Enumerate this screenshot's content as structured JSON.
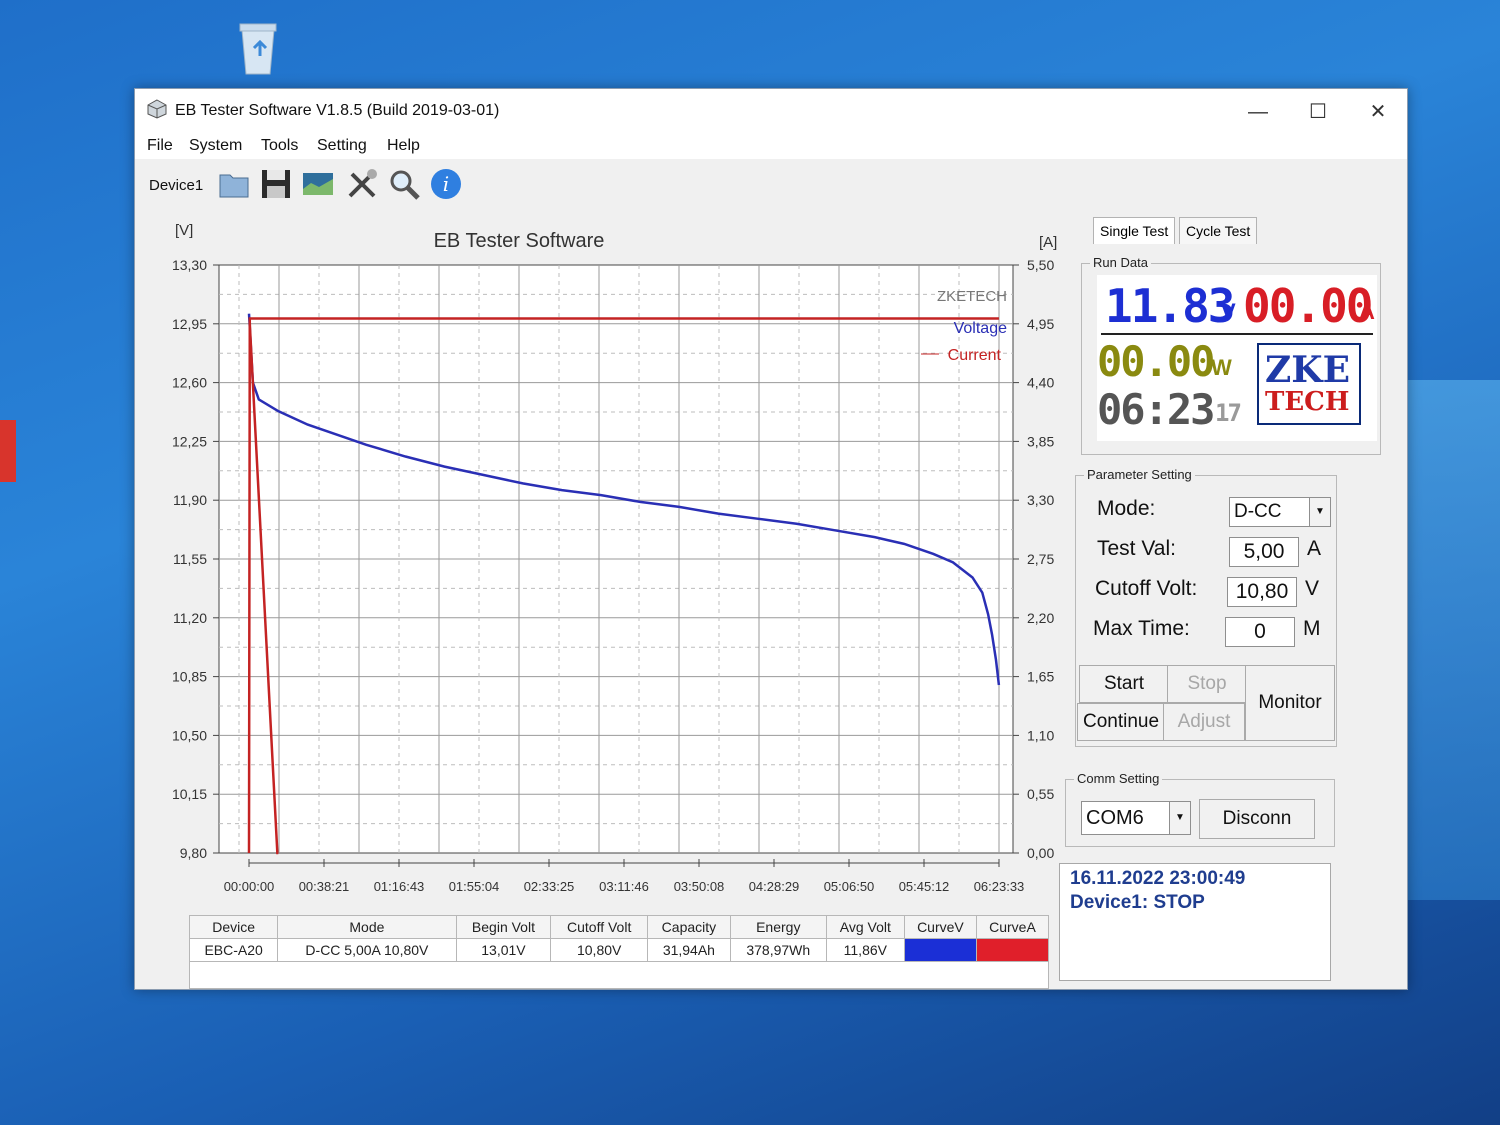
{
  "window": {
    "title": "EB Tester Software V1.8.5 (Build 2019-03-01)",
    "controls": [
      "—",
      "☐",
      "✕"
    ]
  },
  "menu": [
    "File",
    "System",
    "Tools",
    "Setting",
    "Help"
  ],
  "toolbar": {
    "device_label": "Device1",
    "icons": [
      "open-icon",
      "save-icon",
      "chart-image-icon",
      "tools-icon",
      "search-icon",
      "info-icon"
    ]
  },
  "chart_data": {
    "type": "line",
    "title": "EB Tester Software",
    "watermark": "ZKETECH",
    "y_left_unit": "[V]",
    "y_right_unit": "[A]",
    "y_left_ticks": [
      "13,30",
      "12,95",
      "12,60",
      "12,25",
      "11,90",
      "11,55",
      "11,20",
      "10,85",
      "10,50",
      "10,15",
      "9,80"
    ],
    "y_right_ticks": [
      "5,50",
      "4,95",
      "4,40",
      "3,85",
      "3,30",
      "2,75",
      "2,20",
      "1,65",
      "1,10",
      "0,55",
      "0,00"
    ],
    "x_ticks": [
      "00:00:00",
      "00:38:21",
      "01:16:43",
      "01:55:04",
      "02:33:25",
      "03:11:46",
      "03:50:08",
      "04:28:29",
      "05:06:50",
      "05:45:12",
      "06:23:33"
    ],
    "ylim_left": [
      9.8,
      13.3
    ],
    "ylim_right": [
      0,
      5.5
    ],
    "xlim_minutes": [
      0,
      383.55
    ],
    "legend": [
      {
        "name": "Voltage",
        "color": "#2a2fb5"
      },
      {
        "name": "Current",
        "color": "#c42323"
      }
    ],
    "series": [
      {
        "name": "Voltage",
        "axis": "left",
        "x_minutes": [
          0,
          2,
          5,
          15,
          30,
          45,
          60,
          80,
          100,
          120,
          140,
          160,
          180,
          200,
          220,
          240,
          260,
          280,
          300,
          320,
          335,
          350,
          360,
          370,
          375,
          378,
          380,
          382,
          383.5
        ],
        "values": [
          13.01,
          12.6,
          12.5,
          12.43,
          12.35,
          12.29,
          12.23,
          12.16,
          12.1,
          12.05,
          12.0,
          11.96,
          11.93,
          11.89,
          11.86,
          11.82,
          11.79,
          11.76,
          11.72,
          11.68,
          11.64,
          11.58,
          11.53,
          11.44,
          11.35,
          11.22,
          11.1,
          10.95,
          10.8
        ]
      },
      {
        "name": "Current",
        "axis": "right",
        "x_minutes": [
          0,
          0.4,
          1,
          383.5
        ],
        "values": [
          0,
          5.0,
          5.0,
          5.0
        ]
      },
      {
        "name": "VoltageDrop",
        "axis": "left",
        "x_minutes": [
          0,
          0.4,
          14.5,
          15
        ],
        "values": [
          12.95,
          12.95,
          9.8,
          9.8
        ]
      }
    ]
  },
  "result_table": {
    "headers": [
      "Device",
      "Mode",
      "Begin Volt",
      "Cutoff Volt",
      "Capacity",
      "Energy",
      "Avg Volt",
      "CurveV",
      "CurveA"
    ],
    "row": [
      "EBC-A20",
      "D-CC 5,00A 10,80V",
      "13,01V",
      "10,80V",
      "31,94Ah",
      "378,97Wh",
      "11,86V",
      "",
      ""
    ],
    "curve_v_color": "#1b2fd6",
    "curve_a_color": "#e01f2a"
  },
  "tabs": [
    "Single Test",
    "Cycle Test"
  ],
  "run_data": {
    "label": "Run Data",
    "voltage": "11.83",
    "voltage_unit": "V",
    "current": "00.00",
    "current_unit": "A",
    "power": "00.00",
    "power_unit": "W",
    "time": "06:23",
    "time_seconds": "17",
    "logo_top": "ZKE",
    "logo_bottom": "TECH"
  },
  "param": {
    "label": "Parameter Setting",
    "mode_label": "Mode:",
    "mode_value": "D-CC",
    "test_label": "Test Val:",
    "test_value": "5,00",
    "test_unit": "A",
    "cutoff_label": "Cutoff Volt:",
    "cutoff_value": "10,80",
    "cutoff_unit": "V",
    "maxtime_label": "Max Time:",
    "maxtime_value": "0",
    "maxtime_unit": "M"
  },
  "buttons": {
    "start": "Start",
    "stop": "Stop",
    "continue": "Continue",
    "adjust": "Adjust",
    "monitor": "Monitor"
  },
  "comm": {
    "label": "Comm Setting",
    "port": "COM6",
    "disconnect": "Disconn"
  },
  "status": {
    "datetime": "16.11.2022 23:00:49",
    "device_state": "Device1: STOP"
  },
  "colors": {
    "voltage_digits": "#1d2fd3",
    "current_digits": "#d81e26",
    "power_digits": "#8a8a10",
    "time_digits": "#555555"
  }
}
